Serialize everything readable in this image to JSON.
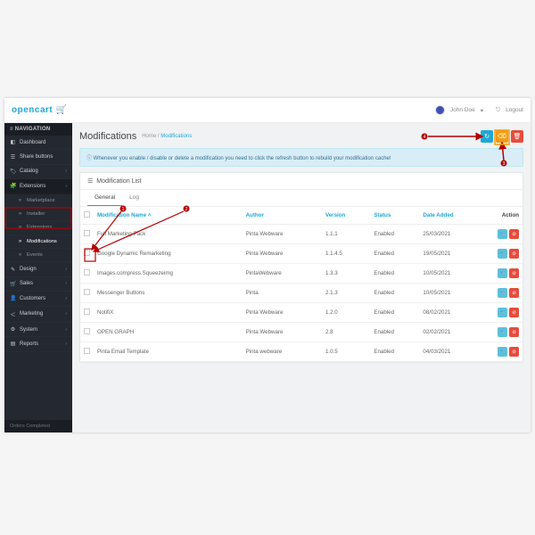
{
  "brand": {
    "name": "opencart"
  },
  "user": {
    "name": "John Doe",
    "logout": "Logout"
  },
  "nav": {
    "heading": "NAVIGATION",
    "items": [
      {
        "icon": "◧",
        "label": "Dashboard",
        "type": "item"
      },
      {
        "icon": "☰",
        "label": "Share buttons",
        "type": "item"
      },
      {
        "icon": "🏷",
        "label": "Catalog",
        "type": "item",
        "chev": true
      },
      {
        "icon": "🧩",
        "label": "Extensions",
        "type": "item",
        "chev": true,
        "active": true
      },
      {
        "label": "Marketplace",
        "type": "sub"
      },
      {
        "label": "Installer",
        "type": "sub"
      },
      {
        "label": "Extensions",
        "type": "sub"
      },
      {
        "label": "Modifications",
        "type": "sub",
        "selected": true
      },
      {
        "label": "Events",
        "type": "sub"
      },
      {
        "icon": "✎",
        "label": "Design",
        "type": "item",
        "chev": true
      },
      {
        "icon": "🛒",
        "label": "Sales",
        "type": "item",
        "chev": true
      },
      {
        "icon": "👤",
        "label": "Customers",
        "type": "item",
        "chev": true
      },
      {
        "icon": "＜",
        "label": "Marketing",
        "type": "item",
        "chev": true
      },
      {
        "icon": "⚙",
        "label": "System",
        "type": "item",
        "chev": true
      },
      {
        "icon": "▤",
        "label": "Reports",
        "type": "item",
        "chev": true
      }
    ],
    "footer": "Orders Completed"
  },
  "page": {
    "title": "Modifications",
    "crumb_home": "Home",
    "crumb_curr": "Modifications",
    "alert": "Whenever you enable / disable or delete a modification you need to click the refresh button to rebuild your modification cache!",
    "panel_title": "Modification List",
    "tabs": {
      "general": "General",
      "log": "Log"
    },
    "columns": {
      "name": "Modification Name ˄",
      "author": "Author",
      "version": "Version",
      "status": "Status",
      "date": "Date Added",
      "action": "Action"
    },
    "rows": [
      {
        "name": "Full Marketing Pack",
        "author": "Pinta Webware",
        "version": "1.1.1",
        "status": "Enabled",
        "date": "25/03/2021"
      },
      {
        "name": "Google Dynamic Remarketing",
        "author": "Pinta Webware",
        "version": "1.1.4.5",
        "status": "Enabled",
        "date": "19/05/2021"
      },
      {
        "name": "Images.compress.Squeezeimg",
        "author": "PintaWebware",
        "version": "1.3.3",
        "status": "Enabled",
        "date": "10/05/2021"
      },
      {
        "name": "Messenger Buttons",
        "author": "Pinta",
        "version": "2.1.3",
        "status": "Enabled",
        "date": "10/05/2021"
      },
      {
        "name": "NotifiX",
        "author": "Pinta Webware",
        "version": "1.2.0",
        "status": "Enabled",
        "date": "08/02/2021"
      },
      {
        "name": "OPEN GRAPH",
        "author": "Pinta Webware",
        "version": "2.8",
        "status": "Enabled",
        "date": "02/02/2021"
      },
      {
        "name": "Pinta Email Template",
        "author": "Pinta webware",
        "version": "1.0.5",
        "status": "Enabled",
        "date": "04/03/2021"
      }
    ]
  },
  "annotations": {
    "n1": "1",
    "n2": "2",
    "n3": "3",
    "n4": "4"
  }
}
